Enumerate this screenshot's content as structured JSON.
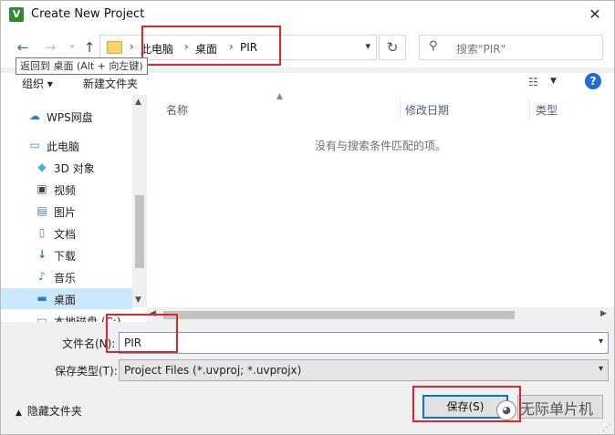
{
  "window": {
    "title": "Create New Project",
    "app_icon": "V"
  },
  "nav": {
    "back_icon": "←",
    "forward_icon": "→",
    "up_icon": "↑"
  },
  "address": {
    "crumbs": [
      "此电脑",
      "桌面",
      "PIR"
    ]
  },
  "search": {
    "placeholder": "搜索\"PIR\""
  },
  "tooltip": "返回到 桌面 (Alt + 向左键)",
  "toolbar": {
    "organize": "组织",
    "new_folder": "新建文件夹"
  },
  "sidebar": {
    "items": [
      {
        "label": "WPS网盘",
        "icon": "cloud-icon",
        "color": "#2f78d0"
      },
      {
        "label": "此电脑",
        "icon": "computer-icon",
        "color": "#3a87d8"
      },
      {
        "label": "3D 对象",
        "icon": "cube-icon",
        "color": "#3fb3e6"
      },
      {
        "label": "视频",
        "icon": "film-icon",
        "color": "#444444"
      },
      {
        "label": "图片",
        "icon": "picture-icon",
        "color": "#4a7fb5"
      },
      {
        "label": "文档",
        "icon": "document-icon",
        "color": "#6b7b8c"
      },
      {
        "label": "下载",
        "icon": "download-icon",
        "color": "#2f78d0"
      },
      {
        "label": "音乐",
        "icon": "music-icon",
        "color": "#2f78d0"
      },
      {
        "label": "桌面",
        "icon": "desktop-icon",
        "color": "#2f78d0"
      },
      {
        "label": "本地磁盘 (C:)",
        "icon": "drive-icon",
        "color": "#6b7b8c"
      }
    ]
  },
  "columns": [
    "名称",
    "修改日期",
    "类型"
  ],
  "empty_message": "没有与搜索条件匹配的项。",
  "form": {
    "filename_label": "文件名(N):",
    "filename_value": "PIR",
    "filetype_label": "保存类型(T):",
    "filetype_value": "Project Files (*.uvproj; *.uvprojx)"
  },
  "footer": {
    "hide_folders": "隐藏文件夹",
    "save": "保存(S)"
  },
  "watermark": "无际单片机",
  "colors": {
    "highlight": "#e0242a",
    "accent": "#0078d7",
    "selection": "#cce8ff"
  }
}
